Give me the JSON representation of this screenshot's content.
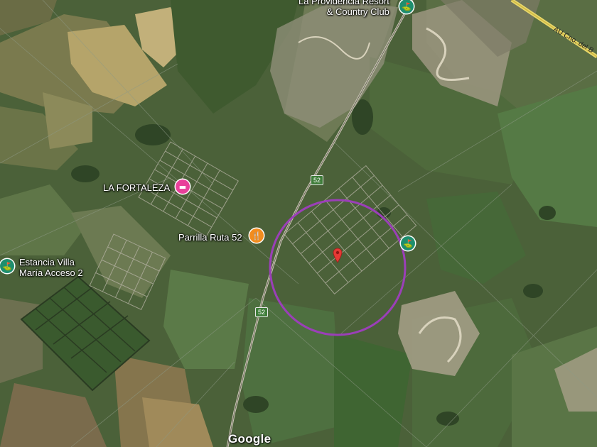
{
  "map": {
    "places": [
      {
        "id": "providencia",
        "name_line1": "La Providencia Resort",
        "name_line2": "& Country Club",
        "icon": "golf-icon",
        "color": "#1e8e6e"
      },
      {
        "id": "la-fortaleza",
        "name": "LA FORTALEZA",
        "icon": "hotel-icon",
        "color": "#e8409a"
      },
      {
        "id": "parrilla",
        "name": "Parrilla Ruta 52",
        "icon": "restaurant-icon",
        "color": "#f28c1e"
      },
      {
        "id": "estancia",
        "name_line1": "Estancia Villa",
        "name_line2": "María Acceso 2",
        "icon": "golf-icon",
        "color": "#1e8e6e"
      },
      {
        "id": "golf-east",
        "name": "",
        "icon": "golf-icon",
        "color": "#1e8e6e"
      }
    ],
    "roads": [
      {
        "id": "ruta-52-north",
        "shield": "52"
      },
      {
        "id": "ruta-52-south",
        "shield": "52"
      },
      {
        "id": "highway",
        "name": "AU Cno. del B"
      }
    ],
    "marker": {
      "icon": "location-pin-icon",
      "color": "#e53935"
    },
    "radius_circle": {
      "color": "#9b3fb8"
    },
    "attribution": "Google"
  }
}
